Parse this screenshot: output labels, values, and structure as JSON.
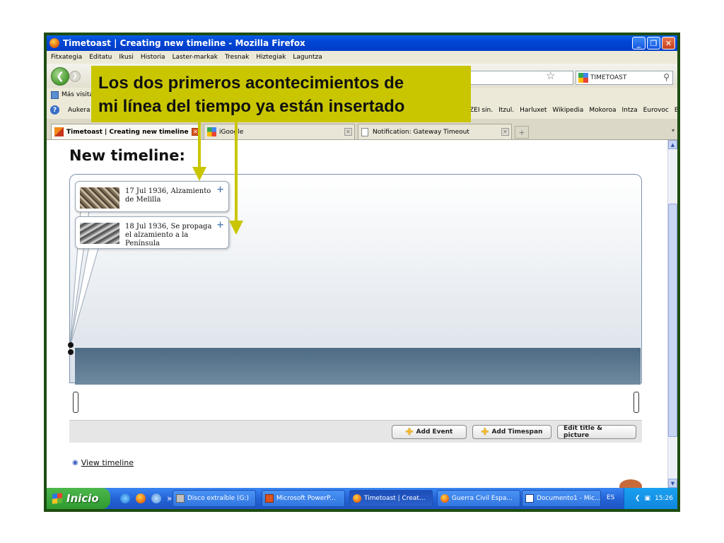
{
  "window": {
    "title": "Timetoast | Creating new timeline - Mozilla Firefox"
  },
  "menubar": {
    "items": [
      "Fitxategia",
      "Editatu",
      "Ikusi",
      "Historia",
      "Laster-markak",
      "Tresnak",
      "Hiztegiak",
      "Laguntza"
    ]
  },
  "navbar": {
    "search_engine_label": "TIMETOAST"
  },
  "bookmarks": {
    "row1_label": "Más visita",
    "row2_left": "Aukera",
    "row2_right": [
      "ZEI sin.",
      "Itzul.",
      "Harluxet",
      "Wikipedia",
      "Mokoroa",
      "Intza",
      "Eurovoc",
      "B"
    ]
  },
  "tabs": [
    {
      "label": "Timetoast | Creating new timeline"
    },
    {
      "label": "iGoogle"
    },
    {
      "label": "Notification: Gateway Timeout"
    }
  ],
  "annotation": {
    "line1": "Los dos primeros acontecimientos de",
    "line2": "mi línea del tiempo ya están insertado",
    "color": "#c9c600"
  },
  "content": {
    "page_title": "New timeline:",
    "events": [
      {
        "text": "17 Jul 1936, Alzamiento de Melilla"
      },
      {
        "text": "18 Jul 1936, Se propaga el alzamiento a la Península"
      }
    ],
    "buttons": {
      "add_event": "Add Event",
      "add_timespan": "Add Timespan",
      "edit_title": "Edit title & picture"
    },
    "view_link": "View timeline"
  },
  "taskbar": {
    "start_label": "Inicio",
    "tasks": [
      {
        "label": "Disco extraíble (G:)"
      },
      {
        "label": "Microsoft PowerP..."
      },
      {
        "label": "Timetoast | Creat..."
      },
      {
        "label": "Guerra Civil Espa..."
      },
      {
        "label": "Documento1 - Mic..."
      }
    ],
    "language": "ES",
    "clock": "15:26"
  },
  "colors": {
    "frame_border": "#1e4d12",
    "xp_blue": "#0046d5",
    "start_green": "#2f9a2f",
    "timeline_strip": "#5a7891"
  }
}
